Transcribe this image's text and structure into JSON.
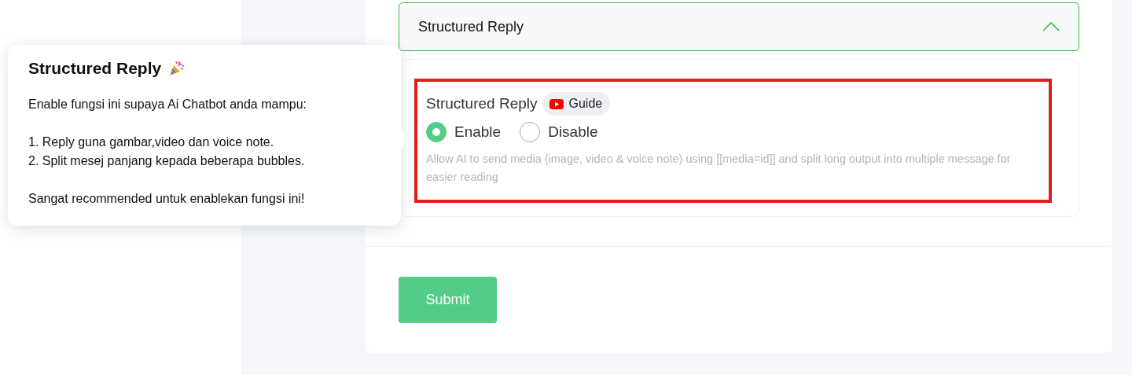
{
  "accordion": {
    "title": "Structured Reply",
    "expanded": true
  },
  "setting": {
    "label": "Structured Reply",
    "guide_label": "Guide",
    "highlighted": true,
    "options": [
      {
        "label": "Enable",
        "selected": true
      },
      {
        "label": "Disable",
        "selected": false
      }
    ],
    "help_text": "Allow AI to send media (image, video & voice note) using [[media=id]] and split long output into multiple message for easier reading"
  },
  "submit_button": "Submit",
  "tooltip": {
    "title": "Structured Reply",
    "intro": "Enable fungsi ini supaya Ai Chatbot anda mampu:",
    "items": [
      "1. Reply guna gambar,video dan voice note.",
      "2. Split mesej panjang kepada beberapa bubbles."
    ],
    "footer": "Sangat recommended untuk enablekan fungsi ini!"
  }
}
